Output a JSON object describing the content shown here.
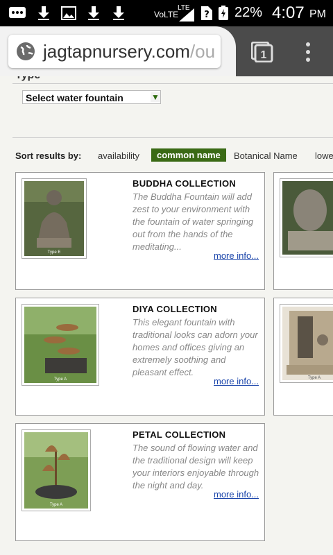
{
  "status_bar": {
    "carrier": "VoLTE",
    "network": "LTE",
    "battery": "22%",
    "time": "4:07",
    "ampm": "PM"
  },
  "browser": {
    "url_main": "jagtapnursery.com",
    "url_faded": "/ou",
    "tab_count": "1"
  },
  "filter": {
    "type_label": "Type",
    "select_value": "Select water fountain"
  },
  "sort": {
    "label": "Sort results by:",
    "options": [
      "availability",
      "common name",
      "Botanical Name",
      "lowe"
    ],
    "active_index": 1
  },
  "products": [
    {
      "title": "BUDDHA COLLECTION",
      "description": "The Buddha Fountain will add zest to your environment with the fountain of water springing out from the hands of the meditating...",
      "more": "more info...",
      "thumb_caption": "Type E"
    },
    {
      "title": "DIYA COLLECTION",
      "description": "This elegant fountain with traditional looks can adorn your homes and offices giving an extremely soothing and pleasant effect.",
      "more": "more info...",
      "thumb_caption": "Type A"
    },
    {
      "title": "PETAL COLLECTION",
      "description": "The sound of flowing water and the traditional design will keep your interiors enjoyable through the night and day.",
      "more": "more info...",
      "thumb_caption": "Type A"
    }
  ],
  "right_thumb_captions": [
    "",
    "Type A"
  ],
  "colors": {
    "status_bg": "#000000",
    "toolbar_bg": "#4b4b4b",
    "active_sort": "#3a6a15",
    "link": "#1a44aa"
  }
}
